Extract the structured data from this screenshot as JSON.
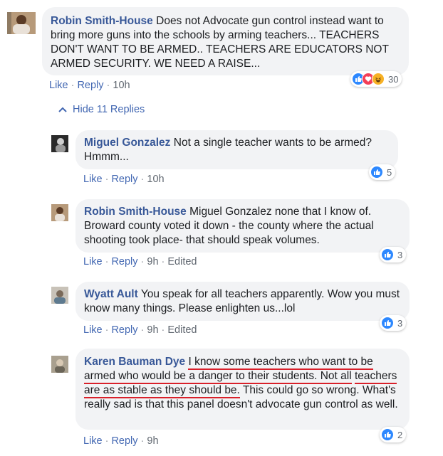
{
  "comments": [
    {
      "author": "Robin Smith-House",
      "text": "Does not Advocate gun control instead want to bring more guns into the schools by arming teachers... TEACHERS DON'T WANT TO BE ARMED.. TEACHERS ARE EDUCATORS NOT ARMED SECURITY. WE NEED A RAISE...",
      "like": "Like",
      "reply": "Reply",
      "time": "10h",
      "reaction_count": "30",
      "reactions": [
        "like",
        "love",
        "haha"
      ]
    },
    {
      "author": "Miguel Gonzalez",
      "text": "Not a single teacher wants to be armed? Hmmm...",
      "like": "Like",
      "reply": "Reply",
      "time": "10h",
      "reaction_count": "5"
    },
    {
      "author": "Robin Smith-House",
      "text": "Miguel Gonzalez none that I know of. Broward county voted it down - the county where the actual shooting took place- that should speak volumes.",
      "like": "Like",
      "reply": "Reply",
      "time": "9h",
      "edited": "Edited",
      "reaction_count": "3"
    },
    {
      "author": "Wyatt Ault",
      "text": "You speak for all teachers apparently. Wow you must know many things. Please enlighten us...lol",
      "like": "Like",
      "reply": "Reply",
      "time": "9h",
      "edited": "Edited",
      "reaction_count": "3"
    },
    {
      "author": "Karen Bauman Dye",
      "text_underlined_1": "I know some teachers who want to be",
      "text_underlined_2": "armed who would be a danger to their students. Not all",
      "text_underlined_3": "teachers are as stable as they should be.",
      "text_rest": " This could go so wrong. What's really sad is that this panel doesn't advocate gun control as well.",
      "like": "Like",
      "reply": "Reply",
      "time": "9h",
      "reaction_count": "2"
    }
  ],
  "hide_replies": "Hide 11 Replies",
  "colors": {
    "like_blue": "#2d88ff",
    "love_red": "#f33e58",
    "haha_yellow": "#f7b125",
    "link_blue": "#385898",
    "bubble_bg": "#f2f3f5"
  }
}
